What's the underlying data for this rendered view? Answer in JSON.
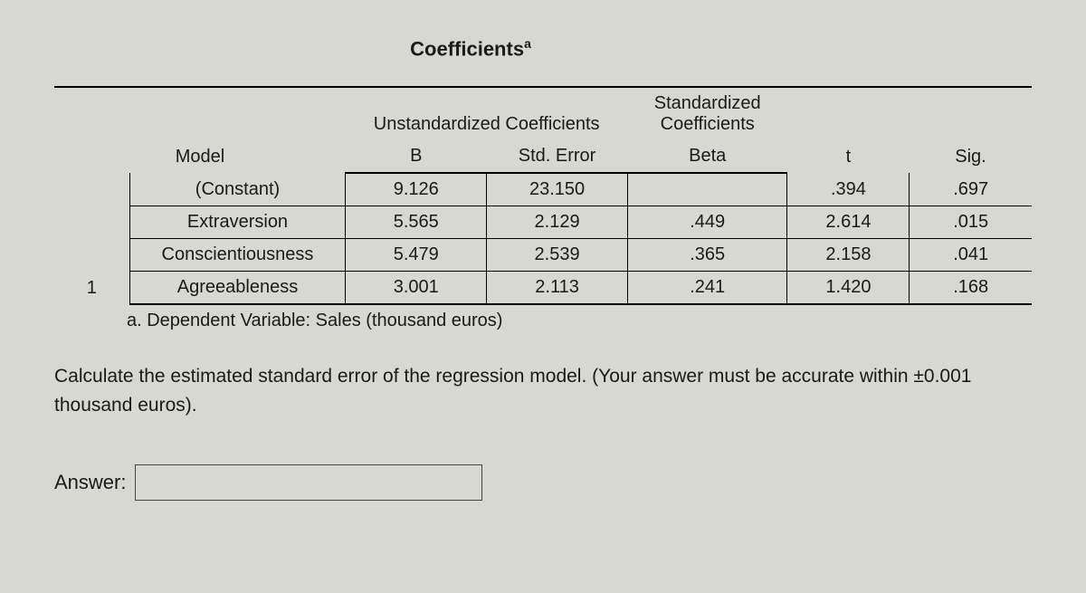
{
  "title": "Coefficients",
  "title_sup": "a",
  "headers": {
    "model": "Model",
    "unstd": "Unstandardized Coefficients",
    "std": "Standardized Coefficients",
    "b": "B",
    "se": "Std. Error",
    "beta": "Beta",
    "t": "t",
    "sig": "Sig."
  },
  "model_num": "1",
  "rows": [
    {
      "name": "(Constant)",
      "b": "9.126",
      "se": "23.150",
      "beta": "",
      "t": ".394",
      "sig": ".697"
    },
    {
      "name": "Extraversion",
      "b": "5.565",
      "se": "2.129",
      "beta": ".449",
      "t": "2.614",
      "sig": ".015"
    },
    {
      "name": "Conscientiousness",
      "b": "5.479",
      "se": "2.539",
      "beta": ".365",
      "t": "2.158",
      "sig": ".041"
    },
    {
      "name": "Agreeableness",
      "b": "3.001",
      "se": "2.113",
      "beta": ".241",
      "t": "1.420",
      "sig": ".168"
    }
  ],
  "footnote": "a. Dependent Variable: Sales (thousand euros)",
  "question": "Calculate the estimated standard error of the regression model. (Your answer must be accurate within ±0.001 thousand euros).",
  "answer_label": "Answer:",
  "chart_data": {
    "type": "table",
    "title": "Coefficients (a)",
    "columns": [
      "Model",
      "Variable",
      "B",
      "Std. Error",
      "Beta",
      "t",
      "Sig."
    ],
    "rows": [
      [
        "1",
        "(Constant)",
        9.126,
        23.15,
        null,
        0.394,
        0.697
      ],
      [
        "1",
        "Extraversion",
        5.565,
        2.129,
        0.449,
        2.614,
        0.015
      ],
      [
        "1",
        "Conscientiousness",
        5.479,
        2.539,
        0.365,
        2.158,
        0.041
      ],
      [
        "1",
        "Agreeableness",
        3.001,
        2.113,
        0.241,
        1.42,
        0.168
      ]
    ],
    "footnote": "a. Dependent Variable: Sales (thousand euros)"
  }
}
